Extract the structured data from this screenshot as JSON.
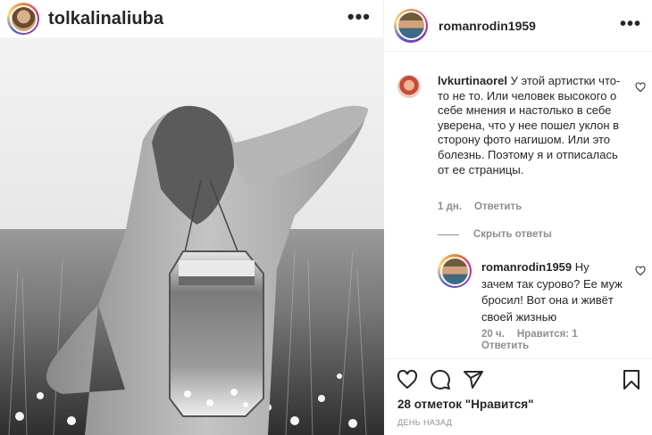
{
  "post": {
    "author": "tolkalinaliuba",
    "more_label": "•••"
  },
  "comments_panel": {
    "header_user": "romanrodin1959",
    "more_label": "•••",
    "comment1": {
      "user": "lvkurtinaorel",
      "text": " У этой артистки что-то не то. Или человек высокого о себе мнения и настолько в себе уверена, что у нее пошел уклон в сторону фото нагишом. Или это болезнь. Поэтому я и отписалась от ее страницы.",
      "time": "1 дн.",
      "reply": "Ответить"
    },
    "hide_replies": "Скрыть ответы",
    "comment2": {
      "user": "romanrodin1959",
      "text": " Ну зачем так сурово? Ее муж бросил! Вот она и живёт своей жизнью",
      "time": "20 ч.",
      "likes": "Нравится: 1",
      "reply": "Ответить"
    }
  },
  "actions": {
    "likes_text": "28 отметок \"Нравится\"",
    "date_text": "ДЕНЬ НАЗАД"
  },
  "icons": [
    "heart-icon",
    "comment-icon",
    "share-icon",
    "bookmark-icon",
    "more-icon"
  ]
}
